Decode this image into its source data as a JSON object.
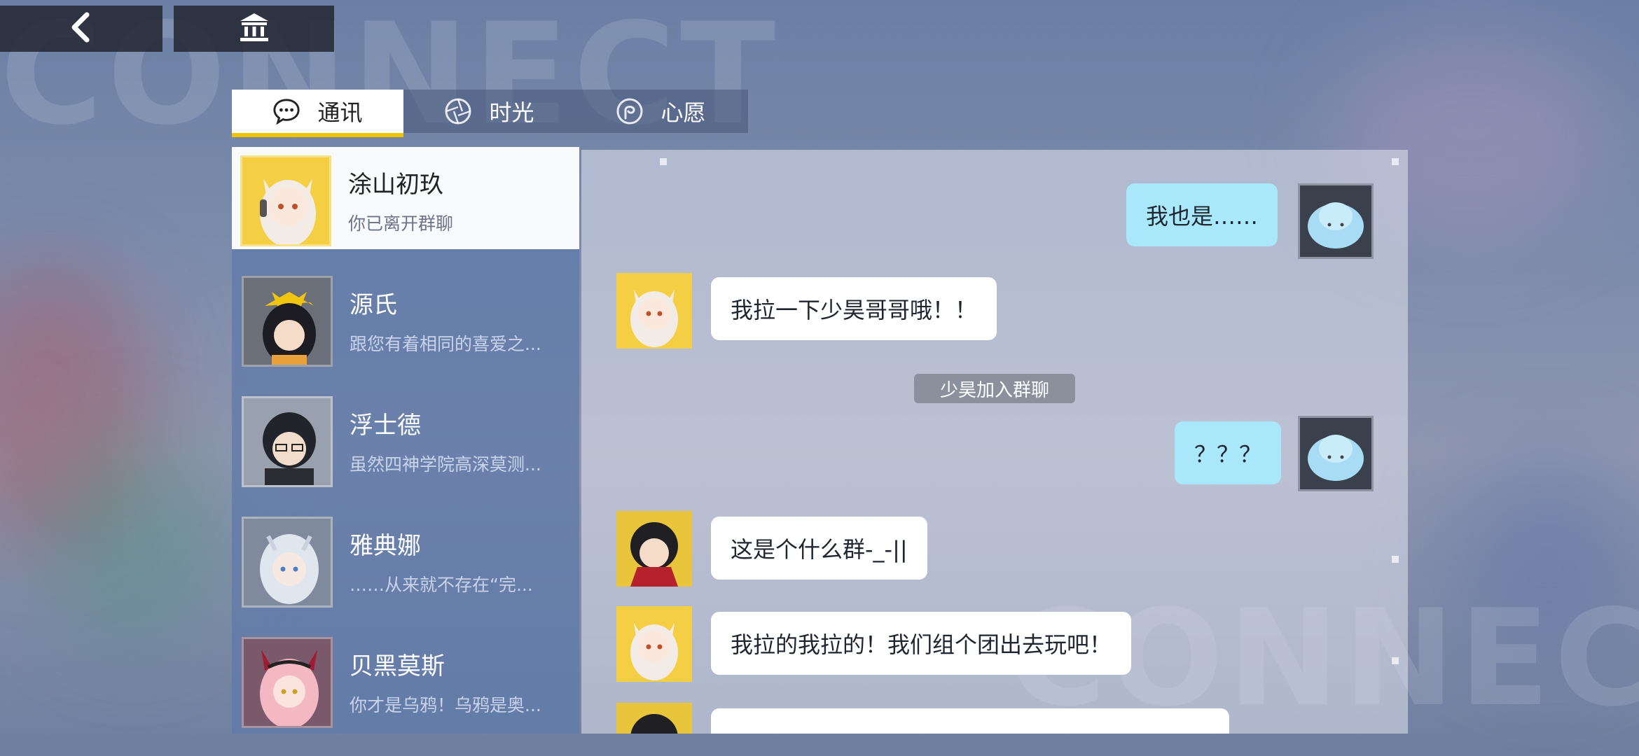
{
  "topbar": {
    "back_icon": "back-chevron-icon",
    "home_icon": "museum-icon"
  },
  "watermarks": {
    "top": "CONNECT",
    "bottom": "CONNECT"
  },
  "tabs": [
    {
      "label": "通讯",
      "icon": "chat-bubble-icon",
      "active": true
    },
    {
      "label": "时光",
      "icon": "aperture-icon",
      "active": false
    },
    {
      "label": "心愿",
      "icon": "wish-swirl-icon",
      "active": false
    }
  ],
  "contacts": [
    {
      "name": "涂山初玖",
      "preview": "你已离开群聊",
      "avatar": "fox-girl-avatar",
      "active": true
    },
    {
      "name": "源氏",
      "preview": "跟您有着相同的喜爱之...",
      "avatar": "black-hair-ribbon-avatar",
      "active": false
    },
    {
      "name": "浮士德",
      "preview": "虽然四神学院高深莫测...",
      "avatar": "glasses-boy-avatar",
      "active": false
    },
    {
      "name": "雅典娜",
      "preview": "……从来就不存在“完...",
      "avatar": "silver-hair-avatar",
      "active": false
    },
    {
      "name": "贝黑莫斯",
      "preview": "你才是乌鸦！乌鸦是奥...",
      "avatar": "pink-hair-avatar",
      "active": false
    }
  ],
  "messages": [
    {
      "from": "me",
      "text": "我也是……"
    },
    {
      "from": "涂山初玖",
      "text": "我拉一下少昊哥哥哦！！"
    },
    {
      "system": true,
      "text": "少昊加入群聊"
    },
    {
      "from": "me",
      "text": "？？？"
    },
    {
      "from": "少昊",
      "text": "这是个什么群-_-||"
    },
    {
      "from": "涂山初玖",
      "text": "我拉的我拉的！我们组个团出去玩吧！"
    }
  ],
  "colors": {
    "accent": "#f2c400",
    "my_bubble": "#a9e7fa",
    "active_marker": "#7c8ee6"
  }
}
